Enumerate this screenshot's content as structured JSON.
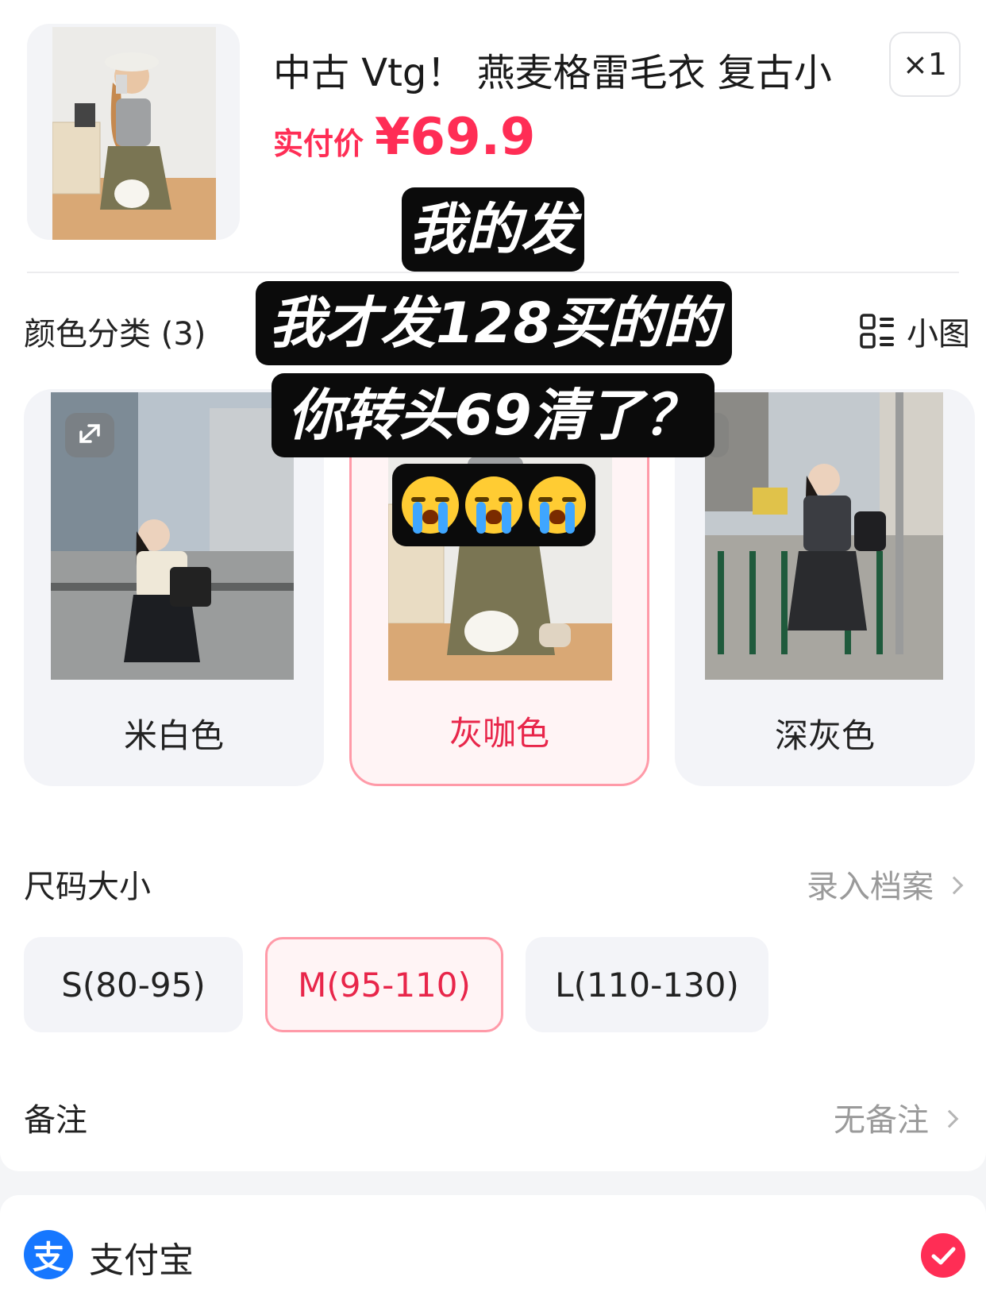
{
  "product": {
    "title": "中古 Vtg！ 燕麦格雷毛衣 复古小",
    "price_label": "实付价",
    "price": "¥69.9",
    "quantity": "×1"
  },
  "color_section": {
    "title": "颜色分类 (3)",
    "view_toggle": "小图",
    "options": [
      {
        "label": "米白色",
        "selected": false
      },
      {
        "label": "灰咖色",
        "selected": true
      },
      {
        "label": "深灰色",
        "selected": false
      }
    ]
  },
  "size_section": {
    "title": "尺码大小",
    "link": "录入档案",
    "options": [
      {
        "label": "S(80-95)",
        "selected": false
      },
      {
        "label": "M(95-110)",
        "selected": true
      },
      {
        "label": "L(110-130)",
        "selected": false
      }
    ]
  },
  "remark_section": {
    "title": "备注",
    "value": "无备注"
  },
  "payment": {
    "label": "支付宝",
    "logo_text": "支",
    "selected": true
  },
  "caption": {
    "line1": "我的发",
    "line2": "我才发128买的的",
    "line3": "你转头69清了？",
    "emoji": "😭😭😭"
  },
  "colors": {
    "accent": "#ff2d55",
    "selected_border": "#ff9aa8",
    "alipay_blue": "#1677ff"
  },
  "icons": [
    "grid-view-icon",
    "expand-icon",
    "chevron-right-icon",
    "checkmark-icon",
    "alipay-logo"
  ]
}
